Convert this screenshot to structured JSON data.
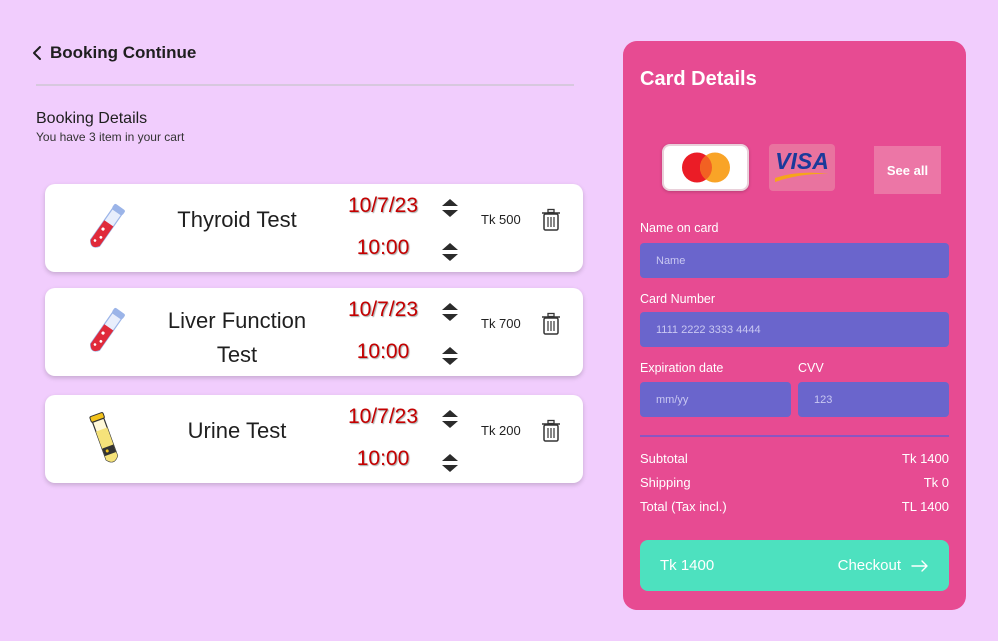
{
  "header": {
    "title": "Booking Continue",
    "section_title": "Booking Details",
    "section_subtitle": "You have 3 item in your cart"
  },
  "cart": [
    {
      "name": "Thyroid Test",
      "date": "10/7/23",
      "time": "10:00",
      "price": "Tk 500",
      "icon": "blood-tube-icon"
    },
    {
      "name": "Liver Function Test",
      "date": "10/7/23",
      "time": "10:00",
      "price": "Tk 700",
      "icon": "blood-tube-icon"
    },
    {
      "name": "Urine Test",
      "date": "10/7/23",
      "time": "10:00",
      "price": "Tk 200",
      "icon": "urine-tube-icon"
    }
  ],
  "panel": {
    "title": "Card Details",
    "see_all": "See all",
    "name_label": "Name on card",
    "name_placeholder": "Name",
    "number_label": "Card Number",
    "number_placeholder": "1111 2222 3333 4444",
    "exp_label": "Expiration date",
    "exp_placeholder": "mm/yy",
    "cvv_label": "CVV",
    "cvv_placeholder": "123",
    "visa_text": "VISA",
    "summary": [
      {
        "label": "Subtotal",
        "value": "Tk 1400"
      },
      {
        "label": "Shipping",
        "value": "Tk 0"
      },
      {
        "label": "Total (Tax incl.)",
        "value": "TL 1400"
      }
    ],
    "checkout_amount": "Tk 1400",
    "checkout_label": "Checkout"
  },
  "colors": {
    "background": "#f1cdfd",
    "panel": "#e74b92",
    "input": "#6a65cc",
    "checkout": "#4de1bf",
    "date_time": "#c40000"
  }
}
